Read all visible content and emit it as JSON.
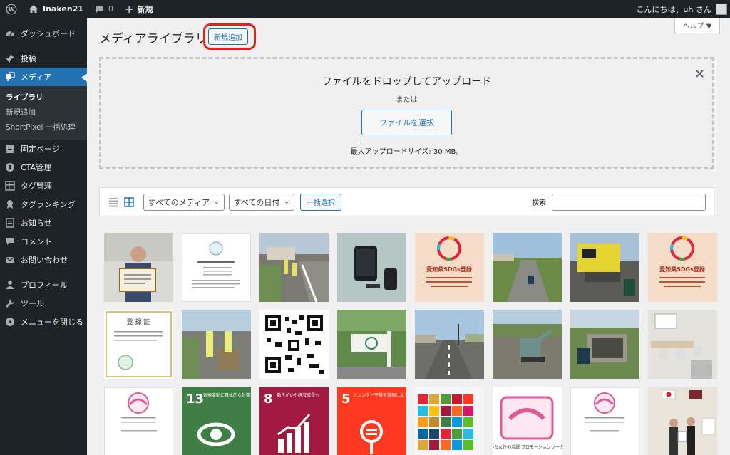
{
  "adminbar": {
    "site_name": "Inaken21",
    "comment_count": "0",
    "new_label": "新規",
    "greeting": "こんにちは、uh さん"
  },
  "sidebar": {
    "items": [
      {
        "label": "ダッシュボード",
        "icon": "dashboard-icon"
      },
      {
        "label": "投稿",
        "icon": "pin-icon"
      },
      {
        "label": "メディア",
        "icon": "media-icon",
        "current": true
      },
      {
        "label": "固定ページ",
        "icon": "page-icon"
      },
      {
        "label": "CTA管理",
        "icon": "megaphone-icon"
      },
      {
        "label": "タグ管理",
        "icon": "tag-grid-icon"
      },
      {
        "label": "タグランキング",
        "icon": "ribbon-icon"
      },
      {
        "label": "お知らせ",
        "icon": "notice-icon"
      },
      {
        "label": "コメント",
        "icon": "comment-icon"
      },
      {
        "label": "お問い合わせ",
        "icon": "mail-icon"
      },
      {
        "label": "プロフィール",
        "icon": "user-icon"
      },
      {
        "label": "ツール",
        "icon": "wrench-icon"
      },
      {
        "label": "メニューを閉じる",
        "icon": "collapse-icon"
      }
    ],
    "submenu": [
      "ライブラリ",
      "新規追加",
      "ShortPixel 一括処理"
    ]
  },
  "help_label": "ヘルプ ▼",
  "page": {
    "title": "メディアライブラリ",
    "add_new": "新規追加"
  },
  "upload": {
    "title": "ファイルをドロップしてアップロード",
    "or": "または",
    "select_button": "ファイルを選択",
    "max_size": "最大アップロードサイズ: 30 MB。"
  },
  "toolbar": {
    "media_filter": "すべてのメディア",
    "date_filter": "すべての日付",
    "bulk_select": "一括選択",
    "search_label": "検索"
  },
  "tile_texts": {
    "sdgs_declared": "愛知県SDGs登録",
    "registration": "登 録 証",
    "goal13": "13",
    "goal13_text": "気候変動に具体的な対策を",
    "goal8": "8",
    "goal8_text": "働きがいも経済成長も",
    "goal5": "5",
    "goal5_text": "ジェンダー平等を実現しよう",
    "women_leader": "あいち女性の活躍 プロモーションリーダー"
  },
  "colors": {
    "admin_dark": "#1d2327",
    "accent_blue": "#2271b1",
    "highlight_red": "#e0241b",
    "goal13_green": "#3f7e44",
    "goal8_maroon": "#a21942",
    "goal5_red": "#ff3a21"
  }
}
